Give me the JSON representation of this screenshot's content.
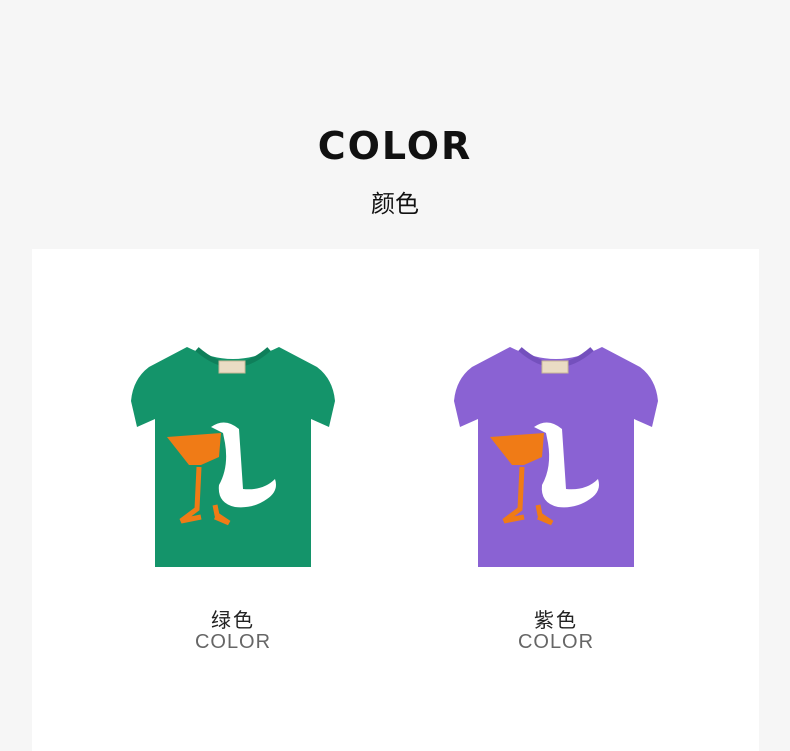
{
  "header": {
    "title": "COLOR",
    "subtitle": "颜色"
  },
  "products": [
    {
      "name": "绿色",
      "sub": "COLOR",
      "color": "#14946a"
    },
    {
      "name": "紫色",
      "sub": "COLOR",
      "color": "#8a62d3"
    }
  ],
  "print": {
    "body_color": "#ffffff",
    "accent_color": "#f07b16"
  }
}
